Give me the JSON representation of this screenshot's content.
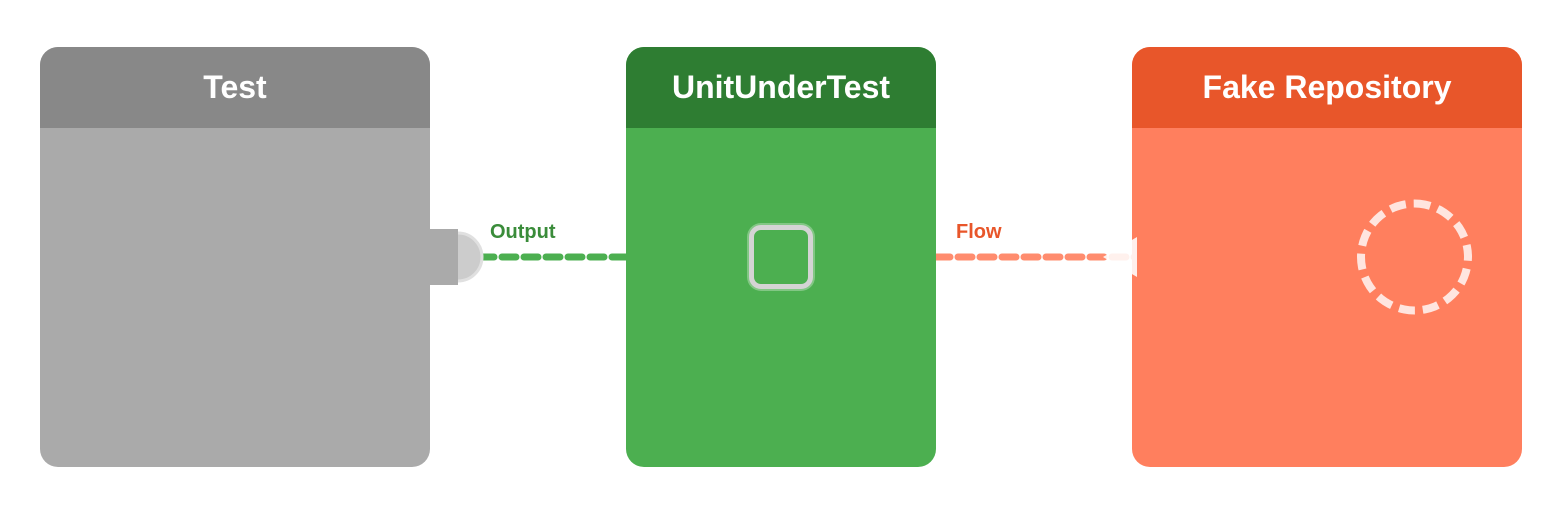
{
  "boxes": {
    "test": {
      "title": "Test",
      "header_bg": "#888888",
      "body_bg": "#aaaaaa"
    },
    "unit": {
      "title": "UnitUnderTest",
      "header_bg": "#2e7d32",
      "body_bg": "#4caf50"
    },
    "fake": {
      "title": "Fake Repository",
      "header_bg": "#e8562a",
      "body_bg": "#ff7f5e"
    }
  },
  "labels": {
    "output": "Output",
    "flow": "Flow"
  },
  "colors": {
    "green_dash": "#4caf50",
    "orange_line": "#ff8c6e",
    "port_border": "#d0d0d0",
    "white": "#ffffff"
  }
}
